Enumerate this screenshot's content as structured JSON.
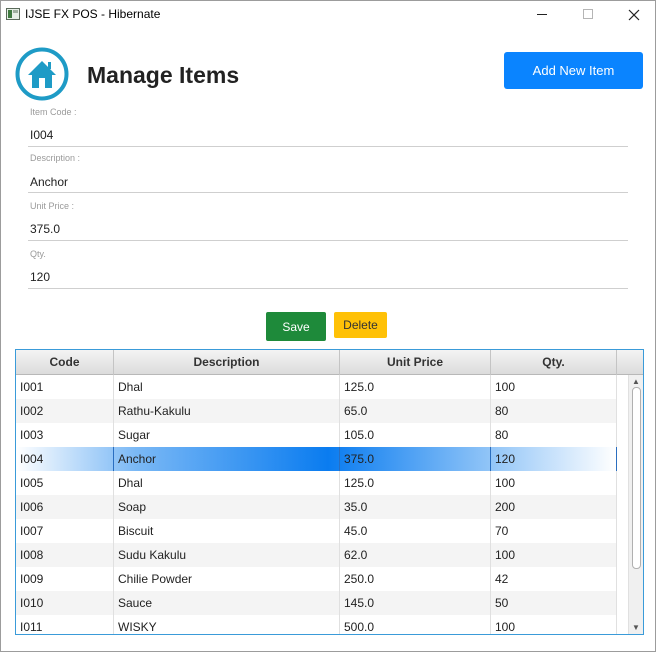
{
  "window": {
    "title": "IJSE FX POS - Hibernate"
  },
  "header": {
    "title": "Manage Items",
    "add_button": "Add New Item"
  },
  "form": {
    "item_code": {
      "label": "Item Code :",
      "value": "I004"
    },
    "description": {
      "label": "Description :",
      "value": "Anchor"
    },
    "unit_price": {
      "label": "Unit Price :",
      "value": "375.0"
    },
    "qty": {
      "label": "Qty.",
      "value": "120"
    }
  },
  "actions": {
    "save": "Save",
    "delete": "Delete"
  },
  "table": {
    "columns": [
      "Code",
      "Description",
      "Unit Price",
      "Qty."
    ],
    "selected_index": 3,
    "rows": [
      [
        "I001",
        "Dhal",
        "125.0",
        "100"
      ],
      [
        "I002",
        "Rathu-Kakulu",
        "65.0",
        "80"
      ],
      [
        "I003",
        "Sugar",
        "105.0",
        "80"
      ],
      [
        "I004",
        "Anchor",
        "375.0",
        "120"
      ],
      [
        "I005",
        "Dhal",
        "125.0",
        "100"
      ],
      [
        "I006",
        "Soap",
        "35.0",
        "200"
      ],
      [
        "I007",
        "Biscuit",
        "45.0",
        "70"
      ],
      [
        "I008",
        "Sudu Kakulu",
        "62.0",
        "100"
      ],
      [
        "I009",
        "Chilie Powder",
        "250.0",
        "42"
      ],
      [
        "I010",
        "Sauce",
        "145.0",
        "50"
      ],
      [
        "I011",
        "WISKY",
        "500.0",
        "100"
      ]
    ]
  },
  "colors": {
    "accent": "#0a84ff",
    "save": "#1e8a3a",
    "delete": "#ffc107",
    "logo": "#1e9bc6"
  }
}
